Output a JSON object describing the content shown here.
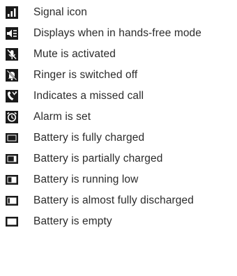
{
  "colors": {
    "icon": "#1a1a1a",
    "text": "#2b2b2b",
    "background": "#ffffff"
  },
  "items": [
    {
      "icon": "signal-icon",
      "label": "Signal icon"
    },
    {
      "icon": "hands-free-icon",
      "label": "Displays when in hands-free mode"
    },
    {
      "icon": "mute-icon",
      "label": "Mute is activated"
    },
    {
      "icon": "ringer-off-icon",
      "label": "Ringer is switched off"
    },
    {
      "icon": "missed-call-icon",
      "label": "Indicates a missed call"
    },
    {
      "icon": "alarm-icon",
      "label": "Alarm is set"
    },
    {
      "icon": "battery-full-icon",
      "label": "Battery is fully charged",
      "level": 1.0
    },
    {
      "icon": "battery-partial-icon",
      "label": "Battery is partially charged",
      "level": 0.75
    },
    {
      "icon": "battery-low-icon",
      "label": "Battery is running low",
      "level": 0.45
    },
    {
      "icon": "battery-almost-empty-icon",
      "label": "Battery is almost fully discharged",
      "level": 0.22
    },
    {
      "icon": "battery-empty-icon",
      "label": "Battery is empty",
      "level": 0.0
    }
  ]
}
